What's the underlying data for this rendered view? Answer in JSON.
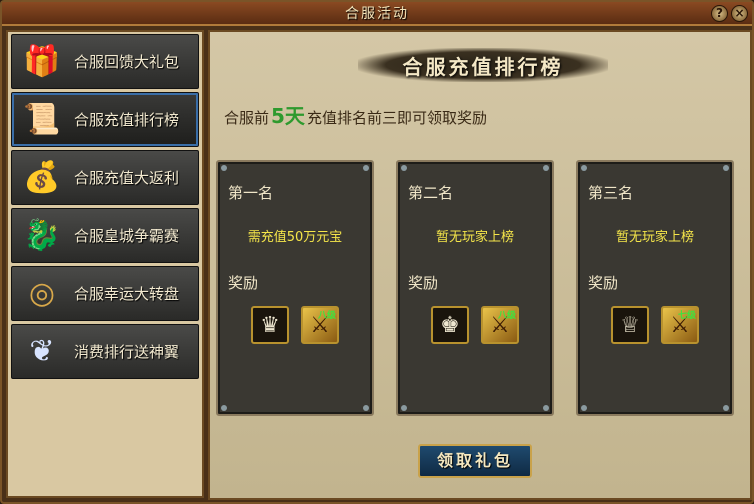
{
  "window": {
    "title": "合服活动",
    "help_label": "?",
    "close_label": "×"
  },
  "sidebar": {
    "items": [
      {
        "label": "合服回馈大礼包",
        "icon": "gift-box-icon",
        "glyph": "🎁",
        "active": false
      },
      {
        "label": "合服充值排行榜",
        "icon": "scroll-icon",
        "glyph": "📜",
        "active": true
      },
      {
        "label": "合服充值大返利",
        "icon": "money-bag-icon",
        "glyph": "💰",
        "active": false
      },
      {
        "label": "合服皇城争霸赛",
        "icon": "dragon-icon",
        "glyph": "🐉",
        "active": false
      },
      {
        "label": "合服幸运大转盘",
        "icon": "wheel-icon",
        "glyph": "◎",
        "active": false
      },
      {
        "label": "消费排行送神翼",
        "icon": "wing-icon",
        "glyph": "❦",
        "active": false
      }
    ]
  },
  "main": {
    "banner": "合服充值排行榜",
    "subtitle": {
      "prefix": "合服前",
      "days": "5天",
      "suffix": "充值排名前三即可领取奖励"
    },
    "cards": [
      {
        "rank": "第一名",
        "requirement": "需充值50万元宝",
        "reward_label": "奖励",
        "items": [
          {
            "icon": "helmet-gold-icon",
            "glyph": "♛"
          },
          {
            "icon": "weapon-fan-icon",
            "glyph": "⚔",
            "badge": "八级"
          }
        ]
      },
      {
        "rank": "第二名",
        "requirement": "暂无玩家上榜",
        "reward_label": "奖励",
        "items": [
          {
            "icon": "helmet-dark-icon",
            "glyph": "♚"
          },
          {
            "icon": "weapon-fan-icon",
            "glyph": "⚔",
            "badge": "八级"
          }
        ]
      },
      {
        "rank": "第三名",
        "requirement": "暂无玩家上榜",
        "reward_label": "奖励",
        "items": [
          {
            "icon": "helmet-silver-icon",
            "glyph": "♕"
          },
          {
            "icon": "weapon-fan-icon",
            "glyph": "⚔",
            "badge": "七级"
          }
        ]
      }
    ],
    "claim_button": "领取礼包"
  }
}
